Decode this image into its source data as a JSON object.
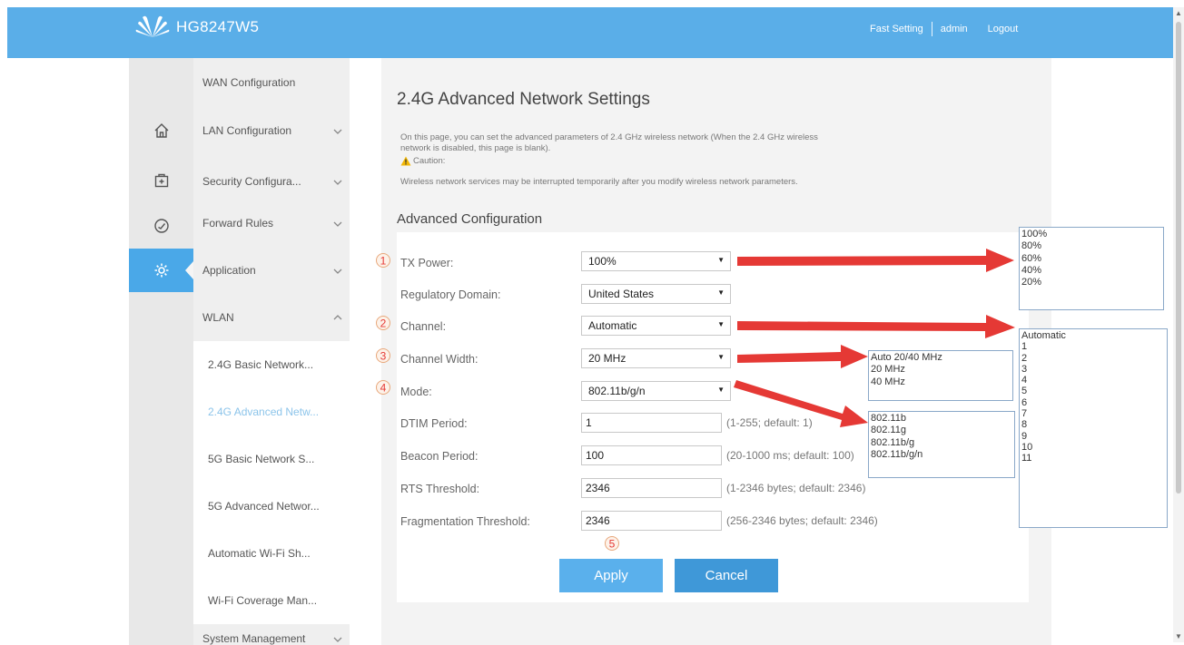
{
  "header": {
    "model": "HG8247W5",
    "links": [
      "Fast Setting",
      "admin",
      "Logout"
    ]
  },
  "colors": {
    "header_bg": "#5aaee8",
    "active_bg": "#4aa8e8",
    "button_apply": "#5ab0ec",
    "button_cancel": "#3f98d8",
    "annotation_red": "#e53935"
  },
  "nav_icons": [
    "home-icon",
    "toolbox-icon",
    "gauge-icon",
    "gear-icon"
  ],
  "sidebar": {
    "items": [
      {
        "label": "WAN Configuration"
      },
      {
        "label": "LAN Configuration"
      },
      {
        "label": "Security Configura..."
      },
      {
        "label": "Forward Rules"
      },
      {
        "label": "Application"
      },
      {
        "label": "WLAN"
      }
    ],
    "sub_items": [
      {
        "label": "2.4G Basic Network..."
      },
      {
        "label": "2.4G Advanced Netw..."
      },
      {
        "label": "5G Basic Network S..."
      },
      {
        "label": "5G Advanced Networ..."
      },
      {
        "label": "Automatic Wi-Fi Sh..."
      },
      {
        "label": "Wi-Fi Coverage Man..."
      }
    ],
    "bottom_item": "System Management"
  },
  "page": {
    "title": "2.4G Advanced Network Settings",
    "description_line1": "On this page, you can set the advanced parameters of 2.4 GHz wireless network (When the 2.4 GHz wireless",
    "description_line2": "network is disabled, this page is blank).",
    "caution_label": "Caution:",
    "caution_text": "Wireless network services may be interrupted temporarily after you modify wireless network parameters.",
    "section_title": "Advanced Configuration"
  },
  "form": {
    "tx_power": {
      "label": "TX Power:",
      "value": "100%"
    },
    "regulatory_domain": {
      "label": "Regulatory Domain:",
      "value": "United States"
    },
    "channel": {
      "label": "Channel:",
      "value": "Automatic"
    },
    "channel_width": {
      "label": "Channel Width:",
      "value": "20 MHz"
    },
    "mode": {
      "label": "Mode:",
      "value": "802.11b/g/n"
    },
    "dtim_period": {
      "label": "DTIM Period:",
      "value": "1",
      "hint": "(1-255; default: 1)"
    },
    "beacon_period": {
      "label": "Beacon Period:",
      "value": "100",
      "hint": "(20-1000 ms; default: 100)"
    },
    "rts_threshold": {
      "label": "RTS Threshold:",
      "value": "2346",
      "hint": "(1-2346 bytes; default: 2346)"
    },
    "fragmentation_threshold": {
      "label": "Fragmentation Threshold:",
      "value": "2346",
      "hint": "(256-2346 bytes; default: 2346)"
    },
    "apply_label": "Apply",
    "cancel_label": "Cancel"
  },
  "annotations": {
    "numbers": [
      "1",
      "2",
      "3",
      "4",
      "5"
    ]
  },
  "dropdown_lists": {
    "tx_power_options": [
      "100%",
      "80%",
      "60%",
      "40%",
      "20%"
    ],
    "channel_options": [
      "Automatic",
      "1",
      "2",
      "3",
      "4",
      "5",
      "6",
      "7",
      "8",
      "9",
      "10",
      "11"
    ],
    "channel_width_options": [
      "Auto 20/40 MHz",
      "20 MHz",
      "40 MHz"
    ],
    "mode_options": [
      "802.11b",
      "802.11g",
      "802.11b/g",
      "802.11b/g/n"
    ]
  }
}
